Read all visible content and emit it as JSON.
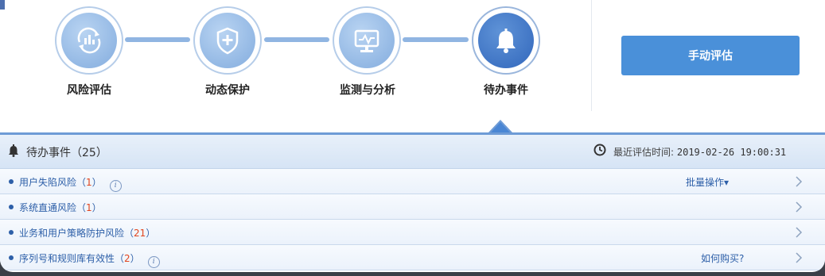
{
  "steps": [
    {
      "label": "风险评估",
      "icon": "risk-assessment-icon"
    },
    {
      "label": "动态保护",
      "icon": "shield-plus-icon"
    },
    {
      "label": "监测与分析",
      "icon": "monitor-chart-icon"
    },
    {
      "label": "待办事件",
      "icon": "bell-icon",
      "active": true
    }
  ],
  "eval_button": "手动评估",
  "panel": {
    "title": "待办事件（25）",
    "last_eval_label": "最近评估时间:",
    "last_eval_value": "2019-02-26 19:00:31"
  },
  "rows": [
    {
      "label": "用户失陷风险",
      "count": "1",
      "has_info": true,
      "action": "批量操作▾"
    },
    {
      "label": "系统直通风险",
      "count": "1",
      "has_info": false,
      "action": ""
    },
    {
      "label": "业务和用户策略防护风险",
      "count": "21",
      "has_info": false,
      "action": ""
    },
    {
      "label": "序列号和规则库有效性",
      "count": "2",
      "has_info": true,
      "action": "如何购买?"
    }
  ],
  "colors": {
    "accent": "#4a90d9",
    "active_step": "#3f74c4",
    "count_red": "#e2451e",
    "link_blue": "#2d5fa8"
  }
}
